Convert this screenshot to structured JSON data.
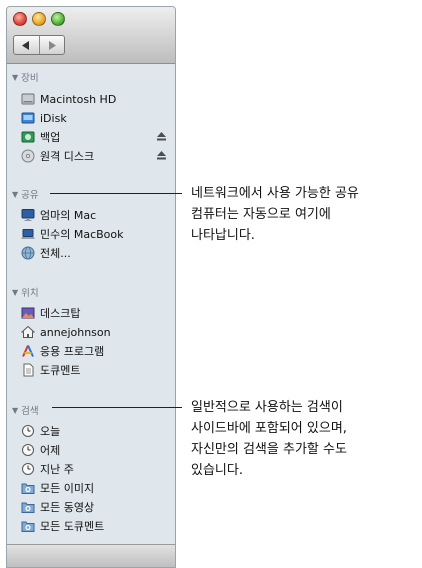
{
  "sidebar": {
    "sections": {
      "devices": {
        "title": "장비",
        "items": [
          {
            "label": "Macintosh HD",
            "icon": "hard-drive-icon"
          },
          {
            "label": "iDisk",
            "icon": "idisk-icon"
          },
          {
            "label": "백업",
            "icon": "backup-disk-icon",
            "eject": true
          },
          {
            "label": "원격 디스크",
            "icon": "remote-disc-icon",
            "eject": true
          }
        ]
      },
      "shared": {
        "title": "공유",
        "items": [
          {
            "label": "엄마의 Mac",
            "icon": "imac-icon"
          },
          {
            "label": "민수의 MacBook",
            "icon": "macbook-icon"
          },
          {
            "label": "전체...",
            "icon": "network-icon"
          }
        ]
      },
      "places": {
        "title": "위치",
        "items": [
          {
            "label": "데스크탑",
            "icon": "desktop-icon"
          },
          {
            "label": "annejohnson",
            "icon": "home-icon"
          },
          {
            "label": "응용 프로그램",
            "icon": "applications-icon"
          },
          {
            "label": "도큐멘트",
            "icon": "documents-icon"
          }
        ]
      },
      "search": {
        "title": "검색",
        "items": [
          {
            "label": "오늘",
            "icon": "clock-icon"
          },
          {
            "label": "어제",
            "icon": "clock-icon"
          },
          {
            "label": "지난 주",
            "icon": "clock-icon"
          },
          {
            "label": "모든 이미지",
            "icon": "smart-folder-icon"
          },
          {
            "label": "모든 동영상",
            "icon": "smart-folder-icon"
          },
          {
            "label": "모든 도큐멘트",
            "icon": "smart-folder-icon"
          }
        ]
      }
    }
  },
  "callouts": {
    "shared": {
      "line1": "네트워크에서 사용 가능한 공유",
      "line2": "컴퓨터는 자동으로 여기에",
      "line3": "나타납니다."
    },
    "search": {
      "line1": "일반적으로 사용하는 검색이",
      "line2": "사이드바에 포함되어 있으며,",
      "line3": "자신만의 검색을 추가할 수도",
      "line4": "있습니다."
    }
  }
}
